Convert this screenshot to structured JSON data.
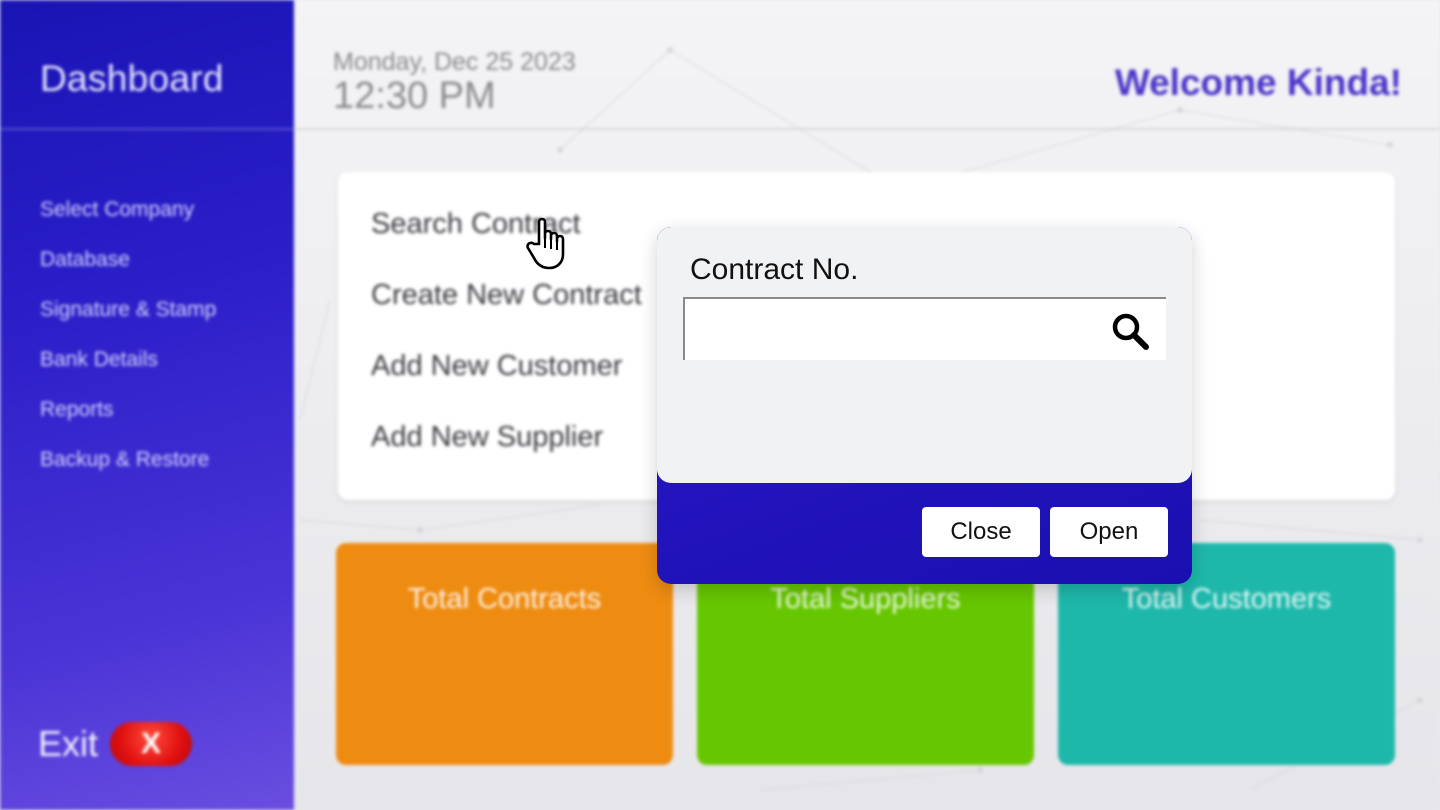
{
  "sidebar": {
    "title": "Dashboard",
    "items": [
      {
        "label": "Select Company"
      },
      {
        "label": "Database"
      },
      {
        "label": "Signature & Stamp"
      },
      {
        "label": "Bank Details"
      },
      {
        "label": "Reports"
      },
      {
        "label": "Backup & Restore"
      }
    ],
    "exit_label": "Exit",
    "exit_button_label": "X"
  },
  "header": {
    "date": "Monday, Dec 25 2023",
    "time": "12:30 PM",
    "welcome": "Welcome Kinda!"
  },
  "actions": [
    {
      "label": "Search Contract"
    },
    {
      "label": "Create New Contract"
    },
    {
      "label": "Add New Customer"
    },
    {
      "label": "Add New Supplier"
    }
  ],
  "stats": [
    {
      "label": "Total Contracts",
      "color": "#ee8c12"
    },
    {
      "label": "Total Suppliers",
      "color": "#66c700"
    },
    {
      "label": "Total Customers",
      "color": "#1eb8ab"
    }
  ],
  "dialog": {
    "label": "Contract No.",
    "input_value": "",
    "close_label": "Close",
    "open_label": "Open"
  },
  "icons": {
    "search": "search-icon",
    "cursor": "pointer-hand-icon"
  },
  "colors": {
    "sidebar_primary": "#1a14b4",
    "sidebar_secondary": "#6a4ee0",
    "welcome_text": "#4a34c8",
    "exit_button": "#e01010"
  }
}
